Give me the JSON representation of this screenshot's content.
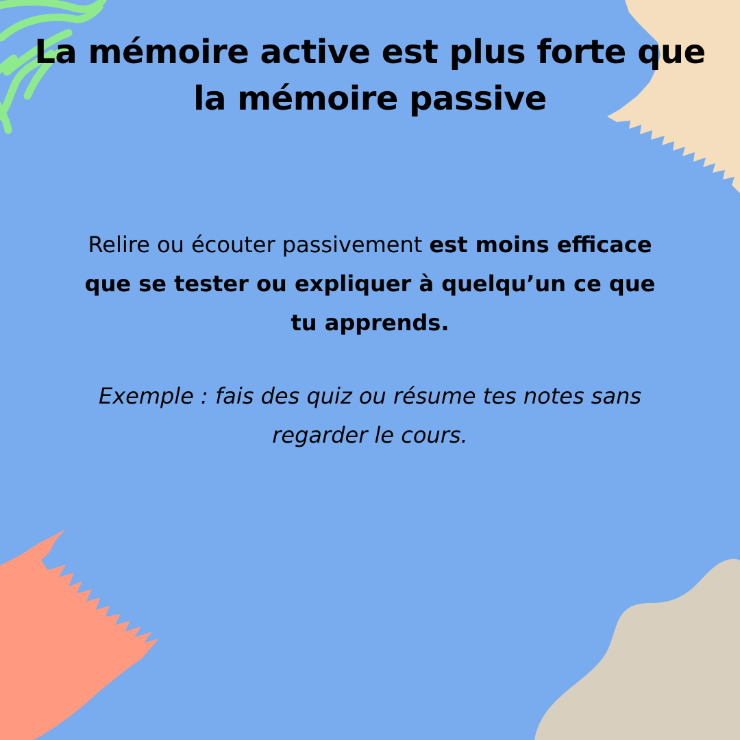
{
  "colors": {
    "background": "#78ACEE",
    "green_stripes": "#8FEA8D",
    "beige_brush": "#F5DEBD",
    "salmon_brush": "#FF9A80",
    "taupe_blob": "#D9CFBE",
    "text": "#000000"
  },
  "decorations": {
    "top_left": "green-wavy-lines",
    "top_right": "beige-brush-stroke",
    "bottom_left": "salmon-brush-stroke",
    "bottom_right": "taupe-blob"
  },
  "title": {
    "line1": "La mémoire active est plus forte que",
    "line2": "la mémoire passive"
  },
  "body": {
    "normal": "Relire ou écouter passivement ",
    "bold": "est moins efficace que se tester ou expliquer à quelqu’un ce que tu apprends."
  },
  "example": {
    "text": "Exemple : fais des quiz ou résume tes notes sans regarder le cours."
  }
}
